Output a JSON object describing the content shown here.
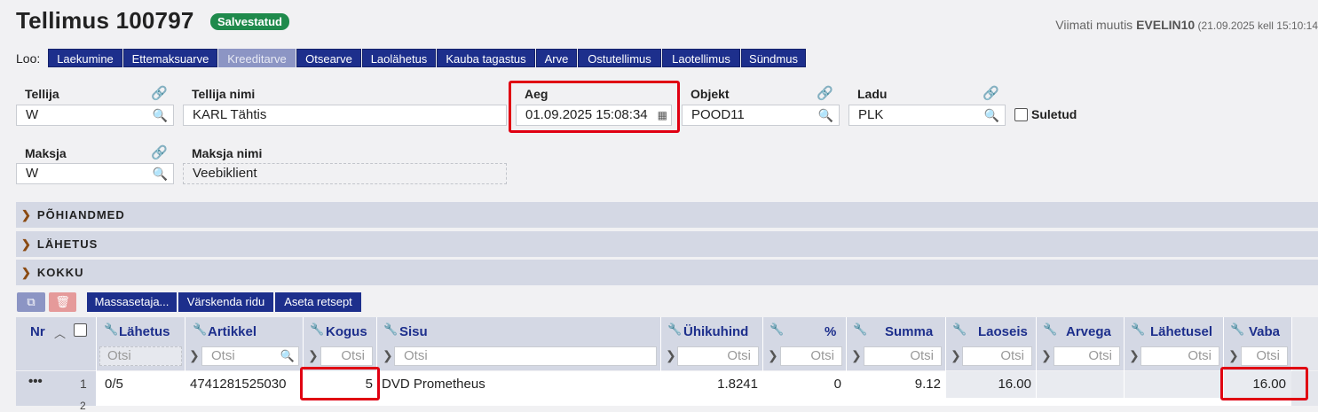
{
  "header": {
    "title": "Tellimus 100797",
    "status_badge": "Salvestatud",
    "last_modified_prefix": "Viimati muutis ",
    "last_modified_user": "EVELIN10",
    "last_modified_time": " (21.09.2025 kell 15:10:14"
  },
  "create_bar": {
    "label": "Loo:",
    "buttons": [
      "Laekumine",
      "Ettemaksuarve",
      "Kreeditarve",
      "Otsearve",
      "Laolähetus",
      "Kauba tagastus",
      "Arve",
      "Ostutellimus",
      "Laotellimus",
      "Sündmus"
    ]
  },
  "form": {
    "tellija_label": "Tellija",
    "tellija_value": "W",
    "tellija_nimi_label": "Tellija nimi",
    "tellija_nimi_value": "KARL Tähtis",
    "aeg_label": "Aeg",
    "aeg_value": "01.09.2025 15:08:34",
    "objekt_label": "Objekt",
    "objekt_value": "POOD11",
    "ladu_label": "Ladu",
    "ladu_value": "PLK",
    "suletud_label": "Suletud",
    "maksja_label": "Maksja",
    "maksja_value": "W",
    "maksja_nimi_label": "Maksja nimi",
    "maksja_nimi_value": "Veebiklient"
  },
  "sections": [
    "PÕHIANDMED",
    "LÄHETUS",
    "KOKKU"
  ],
  "toolbar": {
    "copy_icon": "copy-icon",
    "delete_icon": "trash-icon",
    "buttons": [
      "Massasetaja...",
      "Värskenda ridu",
      "Aseta retsept"
    ]
  },
  "table": {
    "columns": [
      "Nr",
      "Lähetus",
      "Artikkel",
      "Kogus",
      "Sisu",
      "Ühikuhind",
      "%",
      "Summa",
      "Laoseis",
      "Arvega",
      "Lähetusel",
      "Vaba"
    ],
    "filter_placeholder": "Otsi",
    "rows": [
      {
        "menu": "•••",
        "nr": "1",
        "lahetus": "0/5",
        "artikkel": "4741281525030",
        "kogus": "5",
        "sisu": "DVD Prometheus",
        "uhikuhind": "1.8241",
        "protsent": "0",
        "summa": "9.12",
        "laoseis": "16.00",
        "arvega": "",
        "lahetusel": "",
        "vaba": "16.00"
      }
    ],
    "next_row_nr": "2"
  },
  "colors": {
    "accent": "#1d2f8c",
    "highlight": "#e00012",
    "badge": "#1f8a4c"
  }
}
